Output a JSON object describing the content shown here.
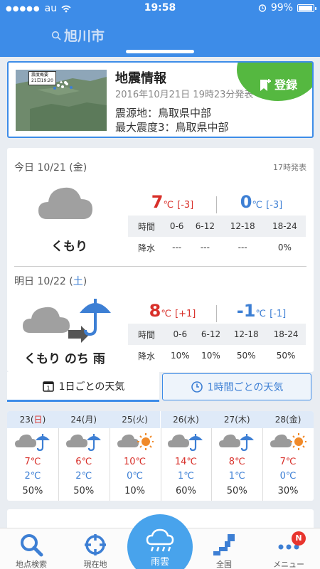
{
  "status": {
    "carrier": "au",
    "signal_dots": "●●●●●",
    "time": "19:58",
    "battery": "99%"
  },
  "header": {
    "location": "旭川市"
  },
  "quake": {
    "title": "地震情報",
    "date": "2016年10月21日 19時23分発表",
    "epicenter": "震源地：鳥取県中部",
    "max_intensity": "最大震度3：鳥取県中部",
    "register": "登録",
    "map_label_1": "震度概要",
    "map_label_2": "21日19:20"
  },
  "today": {
    "label": "今日 10/21 (金)",
    "issued": "17時発表",
    "weather": "くもり",
    "high": "7",
    "high_diff": "[-3]",
    "low": "0",
    "low_diff": "[-3]",
    "unit": "℃",
    "table": {
      "head": [
        "時間",
        "0-6",
        "6-12",
        "12-18",
        "18-24"
      ],
      "row": [
        "降水",
        "---",
        "---",
        "---",
        "0%"
      ]
    }
  },
  "tomorrow": {
    "label_prefix": "明日 10/22 (",
    "label_day": "土",
    "label_suffix": ")",
    "weather": "くもり のち 雨",
    "high": "8",
    "high_diff": "[+1]",
    "low": "-1",
    "low_diff": "[-1]",
    "unit": "℃",
    "table": {
      "head": [
        "時間",
        "0-6",
        "6-12",
        "12-18",
        "18-24"
      ],
      "row": [
        "降水",
        "10%",
        "10%",
        "50%",
        "50%"
      ]
    }
  },
  "tabs": {
    "daily": "1日ごとの天気",
    "hourly": "1時間ごとの天気"
  },
  "weekly": [
    {
      "date": "23",
      "day": "日",
      "hi": "7℃",
      "lo": "2℃",
      "pr": "50%",
      "icon": "cloud-rain",
      "sunday": true
    },
    {
      "date": "24",
      "day": "月",
      "hi": "6℃",
      "lo": "2℃",
      "pr": "50%",
      "icon": "cloud-rain",
      "sunday": false
    },
    {
      "date": "25",
      "day": "火",
      "hi": "10℃",
      "lo": "0℃",
      "pr": "10%",
      "icon": "cloud-sun",
      "sunday": false
    },
    {
      "date": "26",
      "day": "水",
      "hi": "14℃",
      "lo": "1℃",
      "pr": "60%",
      "icon": "rain-cloud",
      "sunday": false
    },
    {
      "date": "27",
      "day": "木",
      "hi": "8℃",
      "lo": "1℃",
      "pr": "50%",
      "icon": "cloud-rain",
      "sunday": false
    },
    {
      "date": "28",
      "day": "金",
      "hi": "7℃",
      "lo": "0℃",
      "pr": "30%",
      "icon": "cloud-sun",
      "sunday": false
    }
  ],
  "nav": {
    "search": "地点検索",
    "current": "現在地",
    "radar": "雨雲",
    "national": "全国",
    "menu": "メニュー",
    "menu_badge": "N"
  },
  "colors": {
    "accent": "#3d8ce8",
    "high": "#d8302a",
    "low": "#3d7fd4",
    "register": "#55b840"
  }
}
